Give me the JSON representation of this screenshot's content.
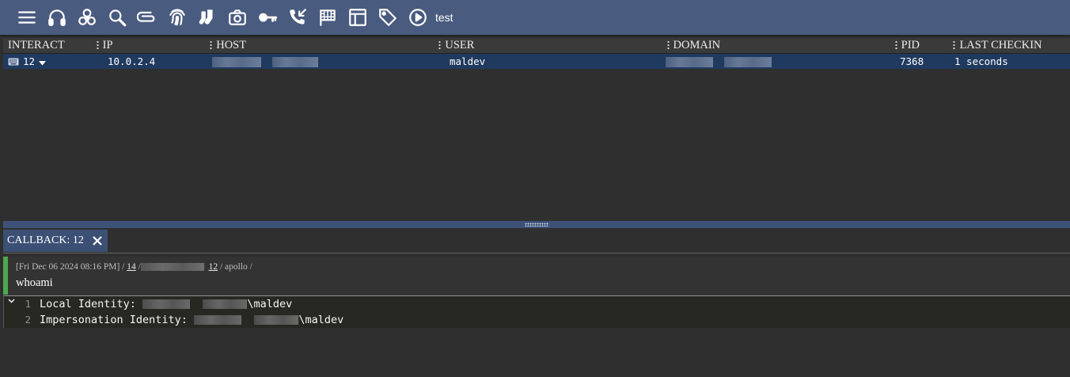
{
  "toolbar": {
    "icons": [
      "menu-icon",
      "headphones-icon",
      "biohazard-icon",
      "search-icon",
      "paperclip-icon",
      "fingerprint-icon",
      "socks-icon",
      "camera-icon",
      "key-icon",
      "phone-incoming-icon",
      "checkered-flag-icon",
      "table-layout-icon",
      "tag-icon",
      "play-circle-icon"
    ],
    "operation_label": "test"
  },
  "grid": {
    "columns": [
      "INTERACT",
      "IP",
      "HOST",
      "USER",
      "DOMAIN",
      "PID",
      "LAST CHECKIN"
    ],
    "row": {
      "callback_id": "12",
      "ip": "10.0.2.4",
      "user": "maldev",
      "pid": "7368",
      "last_checkin": "1 seconds"
    }
  },
  "tab": {
    "label": "CALLBACK: 12"
  },
  "task": {
    "timestamp": "[Fri Dec 06 2024 08:16 PM] / ",
    "task_id": "14",
    "sep1": " /",
    "callback_link": "12",
    "suffix": " / apollo /",
    "command": "whoami"
  },
  "output": {
    "lines": [
      {
        "num": "1",
        "prefix": "Local Identity: ",
        "suffix": "\\maldev"
      },
      {
        "num": "2",
        "prefix": "Impersonation Identity: ",
        "suffix": "\\maldev"
      }
    ]
  }
}
